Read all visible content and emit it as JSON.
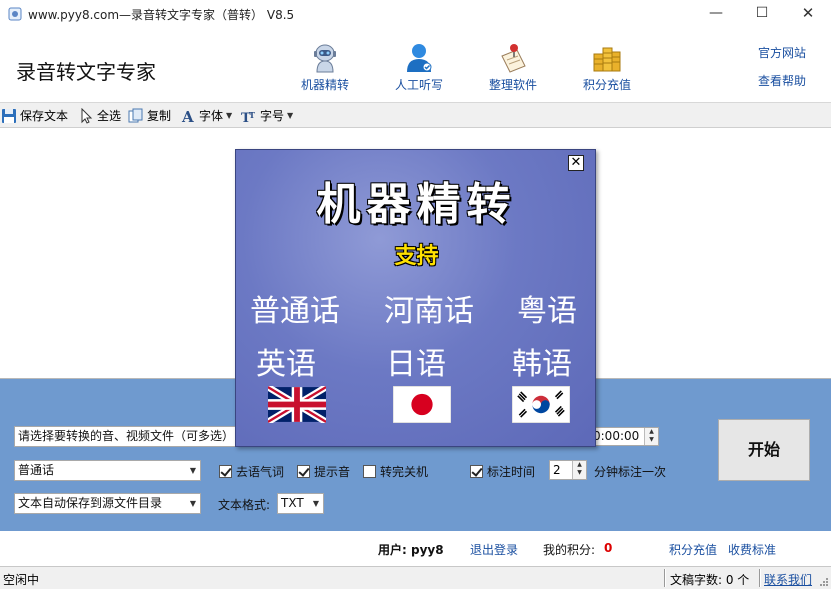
{
  "window": {
    "title": "www.pyy8.com—录音转文字专家（普转） V8.5",
    "minimize": "—",
    "maximize": "☐",
    "close": "✕"
  },
  "header": {
    "app_name": "录音转文字专家",
    "nav": [
      {
        "label": "机器精转",
        "icon": "robot-icon"
      },
      {
        "label": "人工听写",
        "icon": "person-icon"
      },
      {
        "label": "整理软件",
        "icon": "notepad-pin-icon"
      },
      {
        "label": "积分充值",
        "icon": "coins-icon"
      }
    ],
    "links": {
      "official_site": "官方网站",
      "help": "查看帮助"
    }
  },
  "toolbar": {
    "save": "保存文本",
    "select_all": "全选",
    "copy": "复制",
    "font": "字体",
    "font_size": "字号"
  },
  "panel": {
    "file_field": "请选择要转换的音、视频文件（可多选）",
    "time_field": "0:00:00",
    "language": "普通话",
    "save_option": "文本自动保存到源文件目录",
    "remove_filler": {
      "label": "去语气词",
      "checked": true
    },
    "beep": {
      "label": "提示音",
      "checked": true
    },
    "shutdown": {
      "label": "转完关机",
      "checked": false
    },
    "mark_time": {
      "label": "标注时间",
      "checked": true
    },
    "interval_value": "2",
    "interval_label": "分钟标注一次",
    "format_label": "文本格式:",
    "format_value": "TXT",
    "start": "开始"
  },
  "user": {
    "user_label": "用户: pyy8",
    "logout": "退出登录",
    "points_label": "我的积分:",
    "points": "0",
    "recharge": "积分充值",
    "fee": "收费标准"
  },
  "status": {
    "state": "空闲中",
    "word_count": "文稿字数: 0 个",
    "contact": "联系我们"
  },
  "popup": {
    "close": "✕",
    "title": "机器精转",
    "support": "支持",
    "languages": [
      "普通话",
      "河南话",
      "粤语",
      "英语",
      "日语",
      "韩语"
    ],
    "flags": [
      "uk-flag",
      "japan-flag",
      "korea-flag"
    ]
  },
  "colors": {
    "panel_bg": "#6f9acf",
    "link_blue": "#1a4fa0",
    "points_red": "#dd0000",
    "popup_bg": "#6c79c4",
    "popup_support": "#ffe100"
  }
}
